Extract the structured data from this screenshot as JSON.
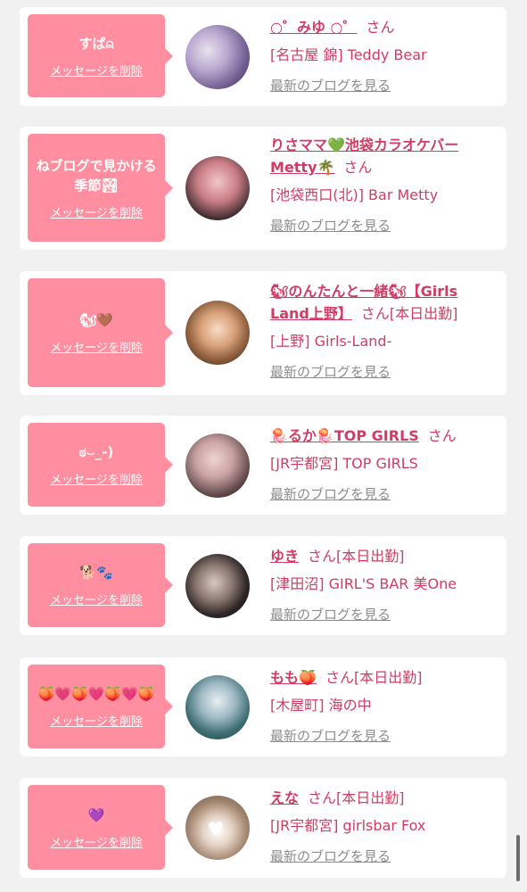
{
  "common": {
    "delete_label": "メッセージを削除",
    "blog_label": "最新のブログを見る",
    "san": "さん",
    "on_duty": "[本日出勤]"
  },
  "colors": {
    "bubble": "#ff8fa0",
    "accent": "#d23b64",
    "muted": "#8c8c8c",
    "background": "#f1f1f1"
  },
  "items": [
    {
      "message": "すぱ⍝",
      "name": "○゜みゆ ○゜",
      "shop": "[名古屋 錦] Teddy Bear",
      "on_duty": ""
    },
    {
      "message": "ねブログで見かける季節🏞",
      "name": "りさママ💚池袋カラオケバーMetty🌴",
      "shop": "[池袋西口(北)] Bar Metty",
      "on_duty": ""
    },
    {
      "message": "🐿🤎",
      "name": "🐿のんたんと一緒🐿【Girls Land上野】",
      "shop": "[上野] Girls-Land-",
      "on_duty": "[本日出勤]"
    },
    {
      "message": "ಠ⌣_-)",
      "name": "🪼るか🪼TOP GIRLS",
      "shop": "[JR宇都宮] TOP GIRLS",
      "on_duty": ""
    },
    {
      "message": "🐕🐾",
      "name": "ゆき",
      "shop": "[津田沼] GIRL'S BAR 美One",
      "on_duty": "[本日出勤]"
    },
    {
      "message": "🍑💗🍑💗🍑💗🍑",
      "name": "もも🍑",
      "shop": "[木屋町] 海の中",
      "on_duty": "[本日出勤]"
    },
    {
      "message": "💜",
      "name": "えな",
      "shop": "[JR宇都宮] girlsbar Fox",
      "on_duty": "[本日出勤]"
    }
  ]
}
